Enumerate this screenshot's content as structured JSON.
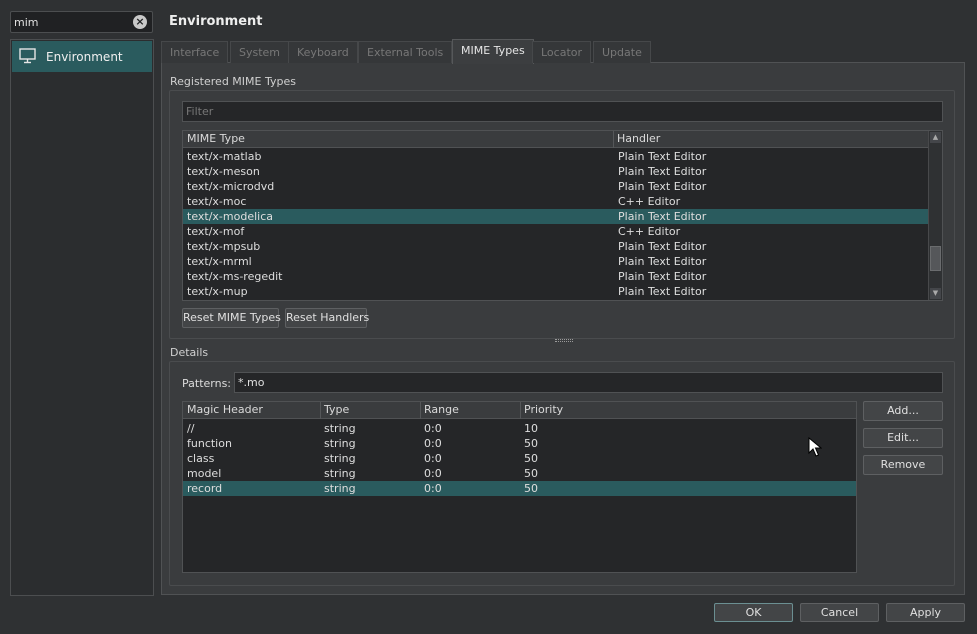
{
  "search": {
    "value": "mim"
  },
  "sidebar": {
    "items": [
      {
        "label": "Environment"
      }
    ]
  },
  "page": {
    "title": "Environment"
  },
  "tabs": [
    {
      "label": "Interface"
    },
    {
      "label": "System"
    },
    {
      "label": "Keyboard"
    },
    {
      "label": "External Tools"
    },
    {
      "label": "MIME Types"
    },
    {
      "label": "Locator"
    },
    {
      "label": "Update"
    }
  ],
  "registered": {
    "title": "Registered MIME Types",
    "filter_placeholder": "Filter",
    "columns": [
      "MIME Type",
      "Handler"
    ],
    "rows": [
      {
        "mime": "text/x-matlab",
        "handler": "Plain Text Editor",
        "selected": false
      },
      {
        "mime": "text/x-meson",
        "handler": "Plain Text Editor",
        "selected": false
      },
      {
        "mime": "text/x-microdvd",
        "handler": "Plain Text Editor",
        "selected": false
      },
      {
        "mime": "text/x-moc",
        "handler": "C++ Editor",
        "selected": false
      },
      {
        "mime": "text/x-modelica",
        "handler": "Plain Text Editor",
        "selected": true
      },
      {
        "mime": "text/x-mof",
        "handler": "C++ Editor",
        "selected": false
      },
      {
        "mime": "text/x-mpsub",
        "handler": "Plain Text Editor",
        "selected": false
      },
      {
        "mime": "text/x-mrml",
        "handler": "Plain Text Editor",
        "selected": false
      },
      {
        "mime": "text/x-ms-regedit",
        "handler": "Plain Text Editor",
        "selected": false
      },
      {
        "mime": "text/x-mup",
        "handler": "Plain Text Editor",
        "selected": false
      }
    ],
    "reset_mime_label": "Reset MIME Types",
    "reset_handlers_label": "Reset Handlers"
  },
  "details": {
    "title": "Details",
    "patterns_label": "Patterns:",
    "patterns_value": "*.mo",
    "columns": [
      "Magic Header",
      "Type",
      "Range",
      "Priority"
    ],
    "rows": [
      {
        "header": "//",
        "type": "string",
        "range": "0:0",
        "priority": "10",
        "selected": false
      },
      {
        "header": "function",
        "type": "string",
        "range": "0:0",
        "priority": "50",
        "selected": false
      },
      {
        "header": "class",
        "type": "string",
        "range": "0:0",
        "priority": "50",
        "selected": false
      },
      {
        "header": "model",
        "type": "string",
        "range": "0:0",
        "priority": "50",
        "selected": false
      },
      {
        "header": "record",
        "type": "string",
        "range": "0:0",
        "priority": "50",
        "selected": true
      }
    ],
    "add_label": "Add...",
    "edit_label": "Edit...",
    "remove_label": "Remove"
  },
  "footer": {
    "ok_label": "OK",
    "cancel_label": "Cancel",
    "apply_label": "Apply"
  },
  "colors": {
    "selection": "#2a5b5e",
    "background": "#2f3133",
    "panel": "#3a3c3e"
  }
}
